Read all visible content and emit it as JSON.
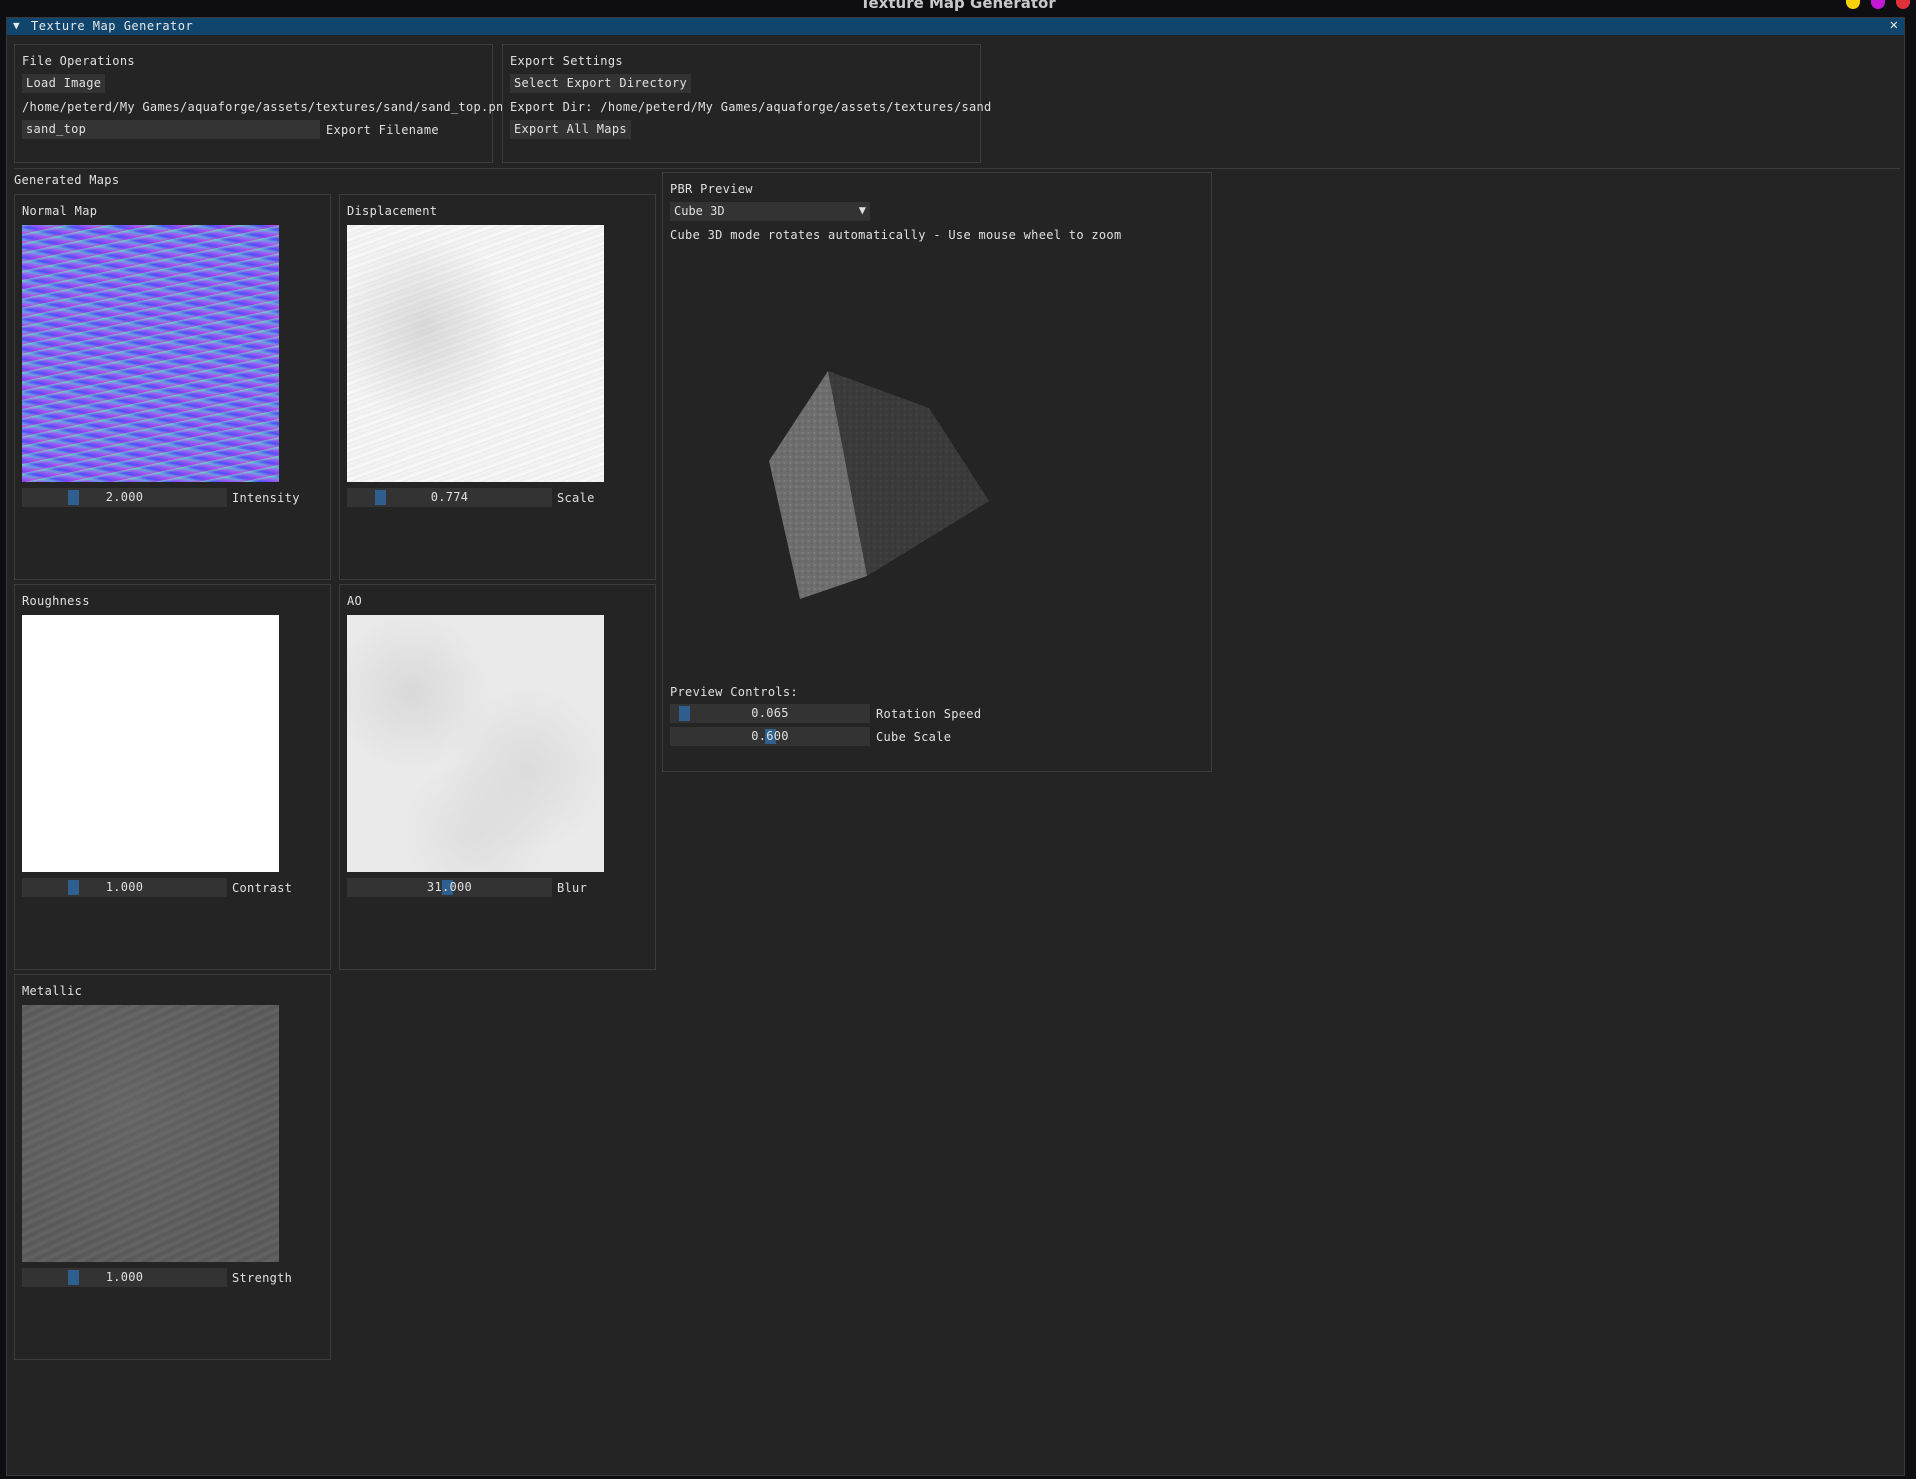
{
  "os": {
    "title": "Texture Map Generator",
    "dots": [
      "#f5d20a",
      "#c418d4",
      "#e0303a"
    ]
  },
  "window": {
    "title": "Texture Map Generator",
    "collapse_glyph": "▼",
    "close_glyph": "✕"
  },
  "file_ops": {
    "title": "File Operations",
    "load_label": "Load Image",
    "path": "/home/peterd/My Games/aquaforge/assets/textures/sand/sand_top.png",
    "filename_value": "sand_top",
    "filename_label": "Export Filename"
  },
  "export_settings": {
    "title": "Export Settings",
    "select_dir_label": "Select Export Directory",
    "export_dir": "Export Dir: /home/peterd/My Games/aquaforge/assets/textures/sand",
    "export_all_label": "Export All Maps"
  },
  "generated_maps": {
    "title": "Generated Maps",
    "maps": [
      {
        "title": "Normal Map",
        "value": "2.000",
        "param": "Intensity",
        "level": 0.25
      },
      {
        "title": "Displacement",
        "value": "0.774",
        "param": "Scale",
        "level": 0.15
      },
      {
        "title": "Roughness",
        "value": "1.000",
        "param": "Contrast",
        "level": 0.25
      },
      {
        "title": "AO",
        "value": "31.000",
        "param": "Blur",
        "level": 0.5
      },
      {
        "title": "Metallic",
        "value": "1.000",
        "param": "Strength",
        "level": 0.25
      }
    ]
  },
  "pbr": {
    "title": "PBR Preview",
    "mode": "Cube 3D",
    "hint": "Cube 3D mode rotates automatically - Use mouse wheel to zoom",
    "controls_title": "Preview Controls:",
    "rotation_value": "0.065",
    "rotation_label": "Rotation Speed",
    "rotation_level": 0.05,
    "scale_value": "0.600",
    "scale_label": "Cube Scale",
    "scale_level": 0.5
  },
  "colors": {
    "accent": "#2e5f8f",
    "title_bar": "#10466e",
    "window_bg": "#242424"
  }
}
